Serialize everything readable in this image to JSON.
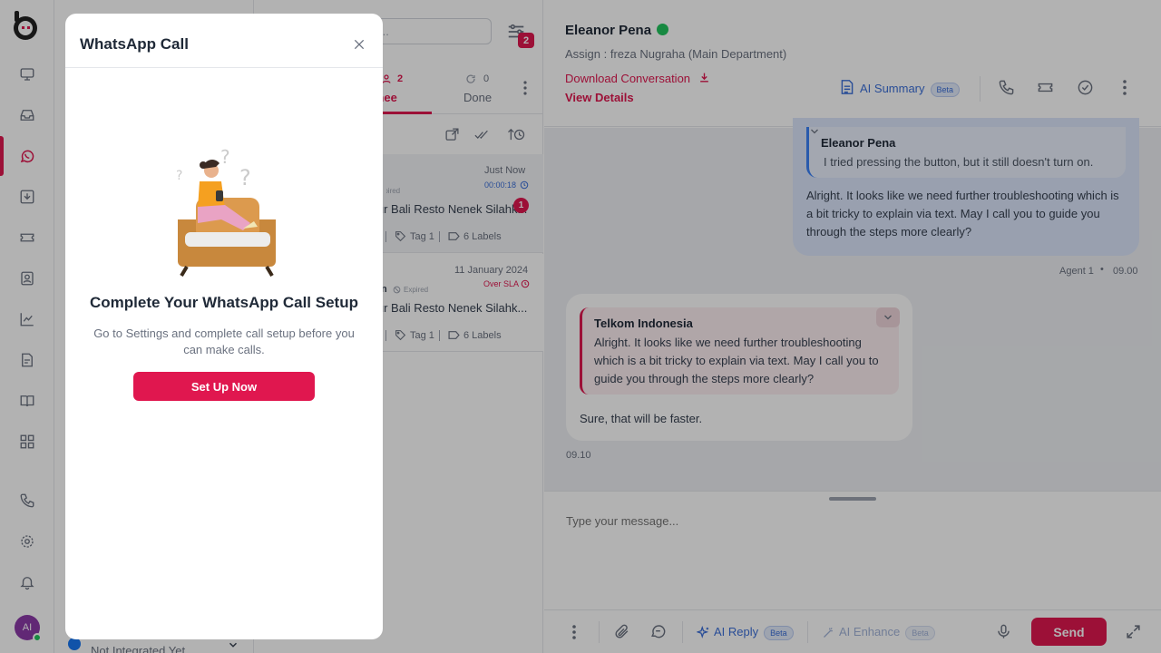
{
  "rail": {
    "avatar_initials": "AI",
    "items": [
      "monitor-icon",
      "inbox-icon",
      "whatsapp-icon",
      "download-icon",
      "ticket-icon",
      "contact-icon",
      "chart-icon",
      "report-icon",
      "book-icon",
      "apps-icon",
      "phone-call-icon",
      "gear-icon",
      "bell-icon"
    ]
  },
  "channel_panel": {
    "channel_label": "Not Integrated Yet"
  },
  "conversation_list": {
    "search_placeholder": "...",
    "filter_count": "2",
    "tabs": [
      {
        "label": "Assignee",
        "count": "2"
      },
      {
        "label": "Done",
        "count": "0"
      }
    ],
    "items": [
      {
        "time": "Just Now",
        "duration": "00:00:18",
        "status": "Expired",
        "title": "Dapur Bali Resto Nenek Silahk...",
        "tag": "Tag 1",
        "labels": "6 Labels",
        "unread": "1"
      },
      {
        "time": "11 January 2024",
        "sla": "Over SLA",
        "name_tail": "n",
        "status": "Expired",
        "title": "Dapur Bali Resto Nenek Silahk...",
        "tag": "Tag 1",
        "labels": "6 Labels"
      }
    ]
  },
  "chat": {
    "contact_name": "Eleanor Pena",
    "assign": "Assign : freza Nugraha (Main Department)",
    "download_label": "Download Conversation",
    "view_details": "View Details",
    "ai_summary": "AI Summary",
    "beta": "Beta",
    "messages": [
      {
        "quote_author": "Eleanor Pena",
        "quote_text": "I tried pressing the button, but it still doesn't turn on.",
        "text": "Alright. It looks like we need further troubleshooting which is a bit tricky to explain via text. May I call you to guide you through the steps more clearly?",
        "agent": "Agent 1",
        "time": "09.00"
      },
      {
        "quote_author": "Telkom Indonesia",
        "quote_text": "Alright. It looks like we need further troubleshooting which is a bit tricky to explain via text. May I call you to guide you through the steps more clearly?",
        "text": "Sure, that will be faster.",
        "time": "09.10"
      }
    ],
    "composer_placeholder": "Type your message...",
    "ai_reply": "AI Reply",
    "ai_enhance": "AI Enhance",
    "send": "Send"
  },
  "modal": {
    "title": "WhatsApp Call",
    "heading": "Complete Your WhatsApp Call Setup",
    "description": "Go to Settings and complete call setup before you can make calls.",
    "button": "Set Up Now"
  },
  "colors": {
    "brand": "#e0174f",
    "link_blue": "#3b6fd8",
    "whatsapp_green": "#22c55e"
  }
}
